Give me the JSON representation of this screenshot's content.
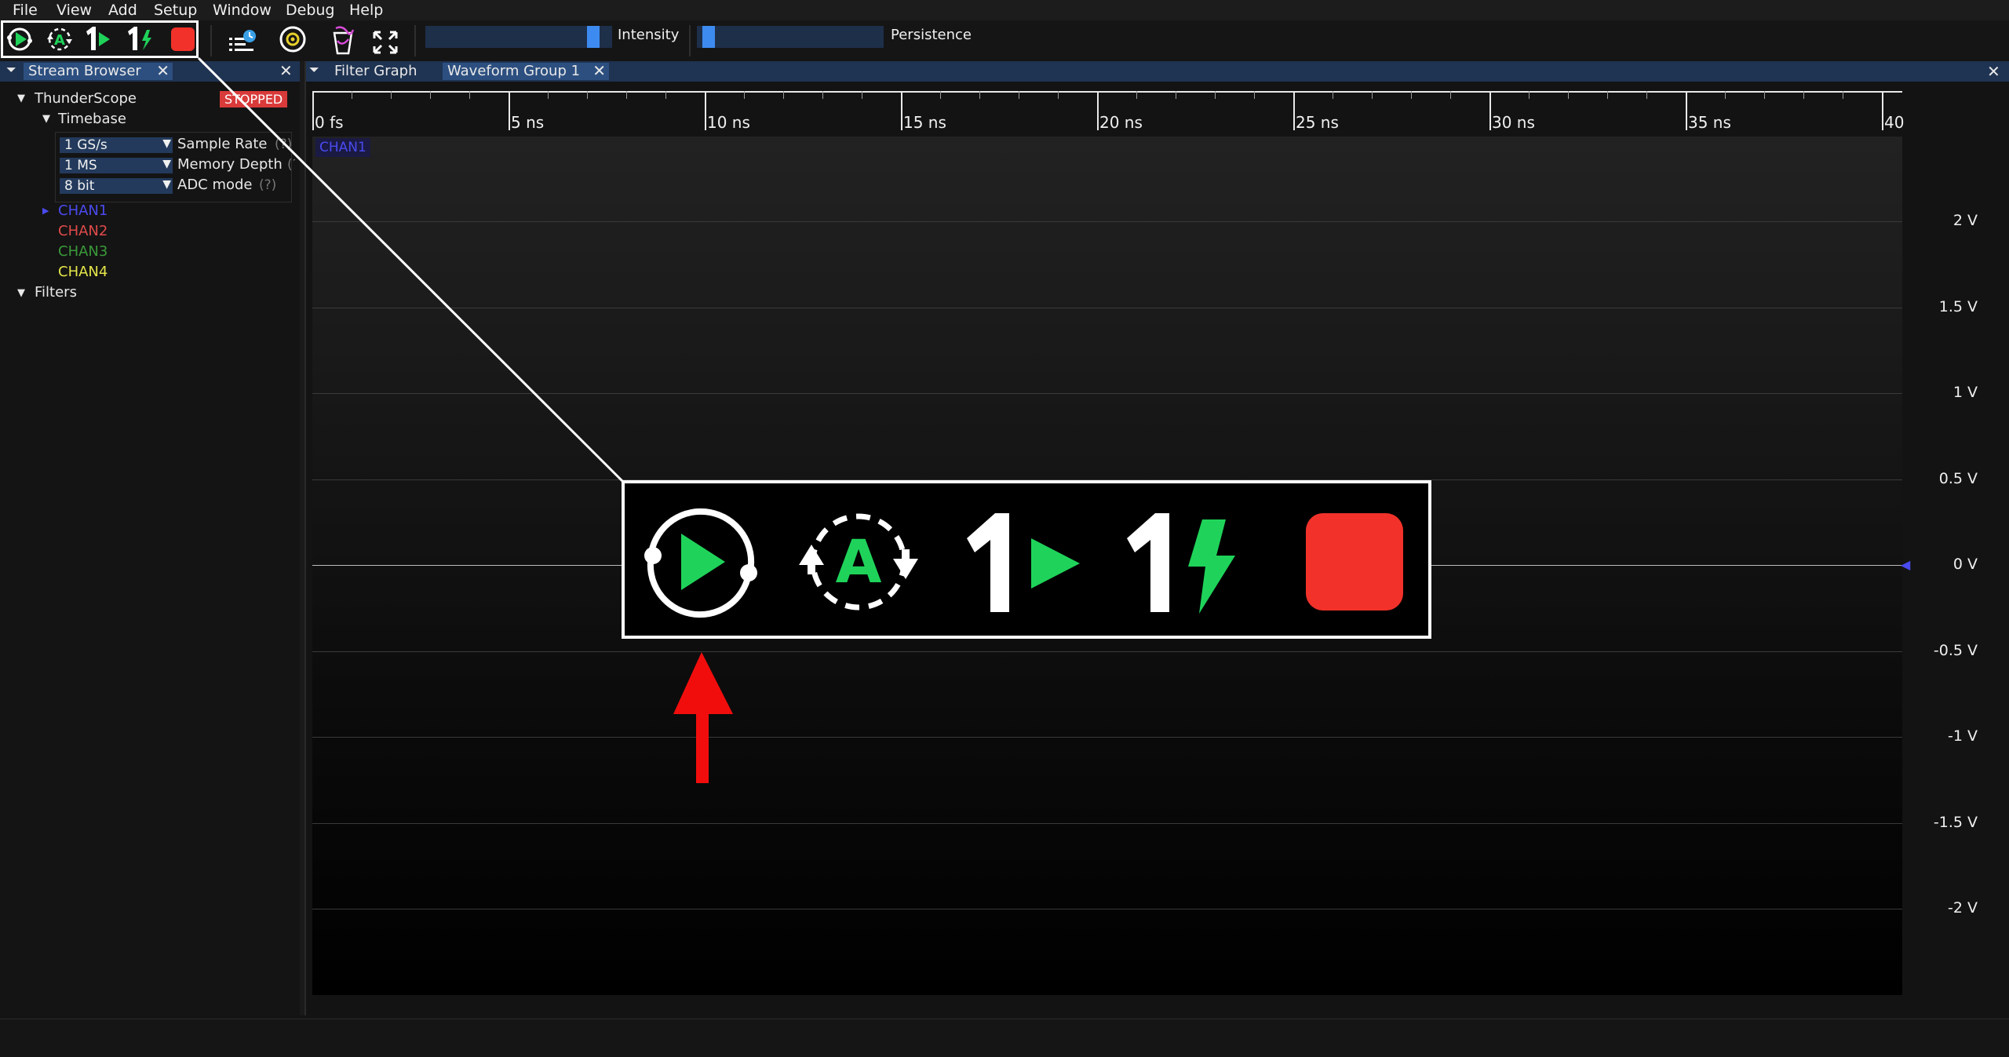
{
  "menu": [
    "File",
    "View",
    "Add",
    "Setup",
    "Window",
    "Debug",
    "Help"
  ],
  "toolbar": {
    "icons": [
      "run-icon",
      "auto-trigger-icon",
      "single-trigger-icon",
      "force-trigger-icon",
      "stop-icon",
      "history-icon",
      "preferences-icon",
      "clear-sweeps-icon",
      "fullscreen-icon"
    ],
    "intensity_label": "Intensity",
    "intensity_value": 0.93,
    "persistence_label": "Persistence",
    "persistence_value": 0.03
  },
  "stream_browser": {
    "tab_label": "Stream Browser",
    "instrument": "ThunderScope",
    "status_badge": "STOPPED",
    "timebase_label": "Timebase",
    "settings": [
      {
        "value": "1 GS/s",
        "label": "Sample Rate",
        "help": "(?)"
      },
      {
        "value": "1 MS",
        "label": "Memory Depth",
        "help": "(?)"
      },
      {
        "value": "8 bit",
        "label": "ADC mode",
        "help": "(?)"
      }
    ],
    "channels": [
      {
        "name": "CHAN1",
        "color": "#4a4af0"
      },
      {
        "name": "CHAN2",
        "color": "#e04a4a"
      },
      {
        "name": "CHAN3",
        "color": "#3a9a3a"
      },
      {
        "name": "CHAN4",
        "color": "#e6e64a"
      }
    ],
    "filters_label": "Filters"
  },
  "tabs": {
    "filter_graph": "Filter Graph",
    "waveform_group": "Waveform Group 1"
  },
  "timeline": {
    "ticks": [
      "0 fs",
      "5 ns",
      "10 ns",
      "15 ns",
      "20 ns",
      "25 ns",
      "30 ns",
      "35 ns",
      "40"
    ]
  },
  "plot": {
    "channel_tag": "CHAN1",
    "volt_labels": [
      "2 V",
      "1.5 V",
      "1 V",
      "0.5 V",
      "0 V",
      "-0.5 V",
      "-1 V",
      "-1.5 V",
      "-2 V"
    ]
  },
  "colors": {
    "run_green": "#1fd35a",
    "stop_red": "#f2322a",
    "accent_blue": "#2c4f80",
    "callout_arrow": "#f20d0d"
  }
}
